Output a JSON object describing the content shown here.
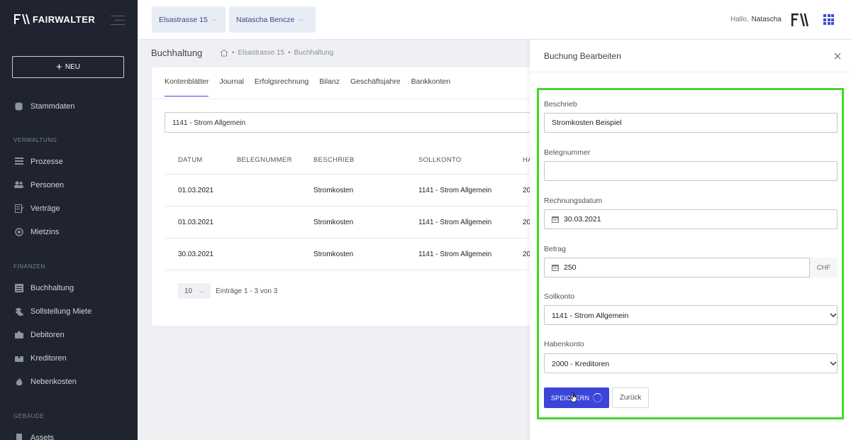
{
  "sidebar": {
    "brand": "FAIRWALTER",
    "new_label": "NEU",
    "items_top": [
      {
        "label": "Stammdaten",
        "icon": "database-icon"
      }
    ],
    "sections": [
      {
        "title": "VERWALTUNG",
        "items": [
          {
            "label": "Prozesse",
            "icon": "list-icon"
          },
          {
            "label": "Personen",
            "icon": "users-icon"
          },
          {
            "label": "Verträge",
            "icon": "contract-icon"
          },
          {
            "label": "Mietzins",
            "icon": "coins-icon"
          }
        ]
      },
      {
        "title": "FINANZEN",
        "items": [
          {
            "label": "Buchhaltung",
            "icon": "ledger-icon"
          },
          {
            "label": "Sollstellung Miete",
            "icon": "coins-stack-icon"
          },
          {
            "label": "Debitoren",
            "icon": "inbox-icon"
          },
          {
            "label": "Kreditoren",
            "icon": "outbox-icon"
          },
          {
            "label": "Nebenkosten",
            "icon": "flame-icon"
          }
        ]
      },
      {
        "title": "GEBÄUDE",
        "items": [
          {
            "label": "Assets",
            "icon": "building-icon"
          }
        ]
      }
    ]
  },
  "topbar": {
    "property": "Elsastrasse 15",
    "person": "Natascha Bencze",
    "greeting": "Hallo,",
    "user": "Natascha"
  },
  "page": {
    "title": "Buchhaltung",
    "breadcrumb": [
      "Elsastrasse 15",
      "Buchhaltung"
    ]
  },
  "tabs": [
    "Kontenblätter",
    "Journal",
    "Erfolgsrechnung",
    "Bilanz",
    "Geschäftsjahre",
    "Bankkonten"
  ],
  "account_filter": "1141 - Strom Allgemein",
  "table": {
    "headers": [
      "DATUM",
      "BELEGNUMMER",
      "BESCHRIEB",
      "SOLLKONTO",
      "HA"
    ],
    "rows": [
      {
        "datum": "01.03.2021",
        "beleg": "",
        "beschrieb": "Stromkosten",
        "soll": "1141 - Strom Allgemein",
        "haben": "20"
      },
      {
        "datum": "01.03.2021",
        "beleg": "",
        "beschrieb": "Stromkosten",
        "soll": "1141 - Strom Allgemein",
        "haben": "20"
      },
      {
        "datum": "30.03.2021",
        "beleg": "",
        "beschrieb": "Stromkosten",
        "soll": "1141 - Strom Allgemein",
        "haben": "20"
      }
    ],
    "per_page": "10",
    "entries_info": "Einträge 1 - 3 von 3"
  },
  "modal": {
    "title": "Buchung Bearbeiten",
    "fields": {
      "beschrieb_label": "Beschrieb",
      "beschrieb_value": "Stromkosten Beispiel",
      "beleg_label": "Belegnummer",
      "beleg_value": "",
      "datum_label": "Rechnungsdatum",
      "datum_value": "30.03.2021",
      "betrag_label": "Betrag",
      "betrag_value": "250",
      "currency": "CHF",
      "soll_label": "Sollkonto",
      "soll_value": "1141 - Strom Allgemein",
      "haben_label": "Habenkonto",
      "haben_value": "2000 - Kreditoren"
    },
    "save_label": "SPEICHERN",
    "back_label": "Zurück"
  },
  "colors": {
    "sidebar": "#1f2430",
    "accent": "#3b46d8",
    "highlight": "#44d62c"
  }
}
